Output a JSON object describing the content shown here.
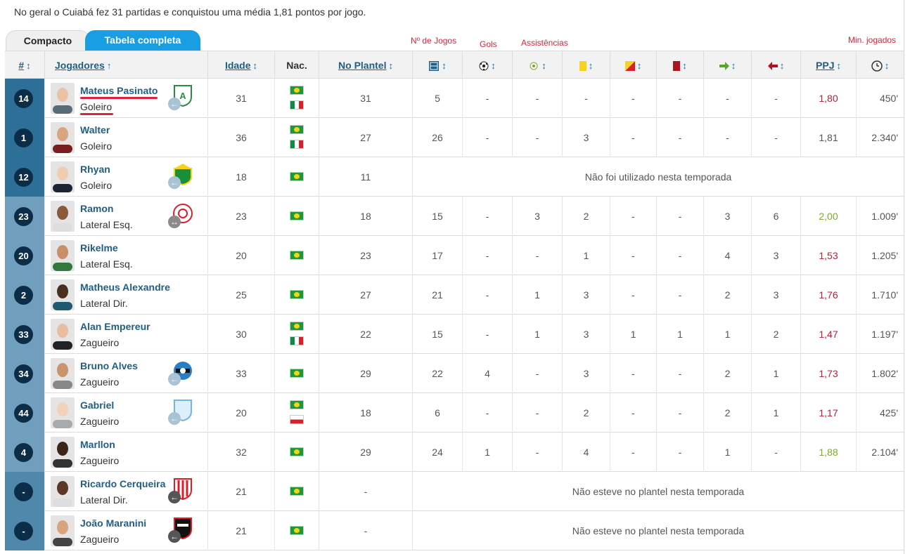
{
  "intro": "No geral o Cuiabá fez 31 partidas e conquistou uma média 1,81 pontos por jogo.",
  "tabs": {
    "compact": "Compacto",
    "full": "Tabela completa"
  },
  "annotations": {
    "jogos": "Nº de Jogos",
    "gols": "Gols",
    "assist": "Assistências",
    "min": "Min. jogados"
  },
  "headers": {
    "num": "#",
    "player": "Jogadores",
    "age": "Idade",
    "nat": "Nac.",
    "squad": "No Plantel",
    "ppj": "PPJ",
    "sort": "↕",
    "sort_up": "↑"
  },
  "icons": {
    "apps": "lineup-icon",
    "goals": "ball-icon",
    "assists": "assist-icon",
    "yellow": "yellow-card-icon",
    "second_yellow": "second-yellow-card-icon",
    "red": "red-card-icon",
    "sub_in": "sub-in-icon",
    "sub_out": "sub-out-icon",
    "minutes": "clock-icon"
  },
  "colors": {
    "accent": "#1a9ee3",
    "link": "#1d5f87",
    "annotation": "#e0213b"
  },
  "rows": [
    {
      "num": "14",
      "name": "Mateus Pasinato",
      "pos": "Goleiro",
      "age": "31",
      "flags": [
        "br",
        "it"
      ],
      "squad": "31",
      "apps": "5",
      "goals": "-",
      "assists": "-",
      "yellow": "-",
      "yr": "-",
      "red": "-",
      "in": "-",
      "out": "-",
      "ppj": "1,80",
      "ppj_color": "red",
      "min": "450'",
      "note": "",
      "transfer": "light",
      "crest": "green"
    },
    {
      "num": "1",
      "name": "Walter",
      "pos": "Goleiro",
      "age": "36",
      "flags": [
        "br",
        "it"
      ],
      "squad": "27",
      "apps": "26",
      "goals": "-",
      "assists": "-",
      "yellow": "3",
      "yr": "-",
      "red": "-",
      "in": "-",
      "out": "-",
      "ppj": "1,81",
      "ppj_color": "dark",
      "min": "2.340'",
      "note": "",
      "transfer": "",
      "crest": ""
    },
    {
      "num": "12",
      "name": "Rhyan",
      "pos": "Goleiro",
      "age": "18",
      "flags": [
        "br"
      ],
      "squad": "11",
      "note": "Não foi utilizado nesta temporada",
      "transfer": "light",
      "crest": "cuiaba"
    },
    {
      "num": "23",
      "name": "Ramon",
      "pos": "Lateral Esq.",
      "age": "23",
      "flags": [
        "br"
      ],
      "squad": "18",
      "apps": "15",
      "goals": "-",
      "assists": "3",
      "yellow": "2",
      "yr": "-",
      "red": "-",
      "in": "3",
      "out": "6",
      "ppj": "2,00",
      "ppj_color": "green",
      "min": "1.009'",
      "note": "",
      "transfer": "swap",
      "crest": "olymp"
    },
    {
      "num": "20",
      "name": "Rikelme",
      "pos": "Lateral Esq.",
      "age": "20",
      "flags": [
        "br"
      ],
      "squad": "23",
      "apps": "17",
      "goals": "-",
      "assists": "-",
      "yellow": "1",
      "yr": "-",
      "red": "-",
      "in": "4",
      "out": "3",
      "ppj": "1,53",
      "ppj_color": "red",
      "min": "1.205'",
      "note": "",
      "transfer": "",
      "crest": ""
    },
    {
      "num": "2",
      "name": "Matheus Alexandre",
      "pos": "Lateral Dir.",
      "age": "25",
      "flags": [
        "br"
      ],
      "squad": "27",
      "apps": "21",
      "goals": "-",
      "assists": "1",
      "yellow": "3",
      "yr": "-",
      "red": "-",
      "in": "2",
      "out": "3",
      "ppj": "1,76",
      "ppj_color": "red",
      "min": "1.710'",
      "note": "",
      "transfer": "",
      "crest": ""
    },
    {
      "num": "33",
      "name": "Alan Empereur",
      "pos": "Zagueiro",
      "age": "30",
      "flags": [
        "br",
        "it"
      ],
      "squad": "22",
      "apps": "15",
      "goals": "-",
      "assists": "1",
      "yellow": "3",
      "yr": "1",
      "red": "1",
      "in": "1",
      "out": "2",
      "ppj": "1,47",
      "ppj_color": "red",
      "min": "1.197'",
      "note": "",
      "transfer": "",
      "crest": ""
    },
    {
      "num": "34",
      "name": "Bruno Alves",
      "pos": "Zagueiro",
      "age": "33",
      "flags": [
        "br"
      ],
      "squad": "29",
      "apps": "22",
      "goals": "4",
      "assists": "-",
      "yellow": "3",
      "yr": "-",
      "red": "-",
      "in": "2",
      "out": "1",
      "ppj": "1,73",
      "ppj_color": "red",
      "min": "1.802'",
      "note": "",
      "transfer": "light",
      "crest": "gremio"
    },
    {
      "num": "44",
      "name": "Gabriel",
      "pos": "Zagueiro",
      "age": "20",
      "flags": [
        "br",
        "pl"
      ],
      "squad": "18",
      "apps": "6",
      "goals": "-",
      "assists": "-",
      "yellow": "2",
      "yr": "-",
      "red": "-",
      "in": "2",
      "out": "1",
      "ppj": "1,17",
      "ppj_color": "red",
      "min": "425'",
      "note": "",
      "transfer": "light",
      "crest": "londrina"
    },
    {
      "num": "4",
      "name": "Marllon",
      "pos": "Zagueiro",
      "age": "32",
      "flags": [
        "br"
      ],
      "squad": "29",
      "apps": "24",
      "goals": "1",
      "assists": "-",
      "yellow": "4",
      "yr": "-",
      "red": "-",
      "in": "1",
      "out": "-",
      "ppj": "1,88",
      "ppj_color": "green",
      "min": "2.104'",
      "note": "",
      "transfer": "",
      "crest": ""
    },
    {
      "num": "-",
      "name": "Ricardo Cerqueira",
      "pos": "Lateral Dir.",
      "age": "21",
      "flags": [
        "br"
      ],
      "squad": "-",
      "note": "Não esteve no plantel nesta temporada",
      "transfer": "dark",
      "crest": "stripes"
    },
    {
      "num": "-",
      "name": "João Maranini",
      "pos": "Zagueiro",
      "age": "21",
      "flags": [
        "br"
      ],
      "squad": "-",
      "note": "Não esteve no plantel nesta temporada",
      "transfer": "dark",
      "crest": "botafogo"
    }
  ]
}
